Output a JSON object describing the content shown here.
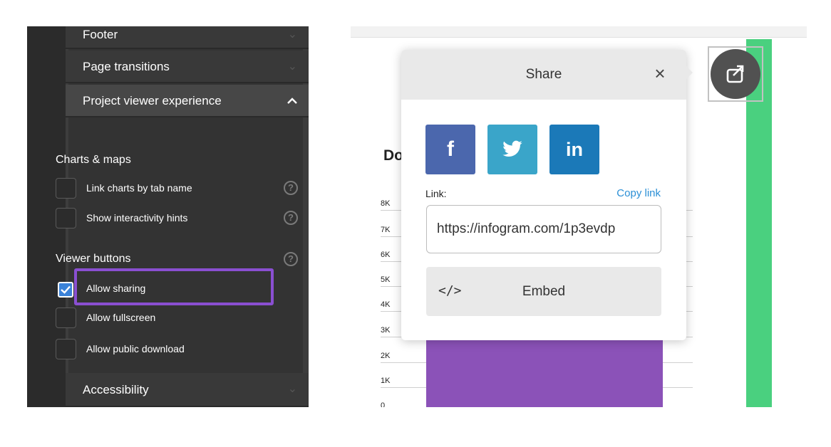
{
  "settings": {
    "sections": {
      "footer": "Footer",
      "page_transitions": "Page transitions",
      "viewer_experience": "Project viewer experience",
      "accessibility": "Accessibility"
    },
    "charts_maps": {
      "title": "Charts & maps",
      "options": [
        "Link charts by tab name",
        "Show interactivity hints"
      ]
    },
    "viewer_buttons": {
      "title": "Viewer buttons",
      "options": [
        {
          "label": "Allow sharing",
          "checked": true
        },
        {
          "label": "Allow fullscreen",
          "checked": false
        },
        {
          "label": "Allow public download",
          "checked": false
        }
      ]
    },
    "help_glyph": "?",
    "highlight_color": "#8a4fd1"
  },
  "preview": {
    "chart_title_fragment": "Do",
    "y_ticks": [
      "8K",
      "7K",
      "6K",
      "5K",
      "4K",
      "3K",
      "2K",
      "1K",
      "0"
    ],
    "share_popup": {
      "title": "Share",
      "close": "×",
      "social": {
        "facebook": "f",
        "linkedin": "in"
      },
      "link_label": "Link:",
      "copy_link": "Copy link",
      "link_value": "https://infogram.com/1p3evdp",
      "embed_icon": "</>",
      "embed_label": "Embed"
    },
    "accent_green": "#4ad07f",
    "bar_color": "#8b52b8"
  }
}
